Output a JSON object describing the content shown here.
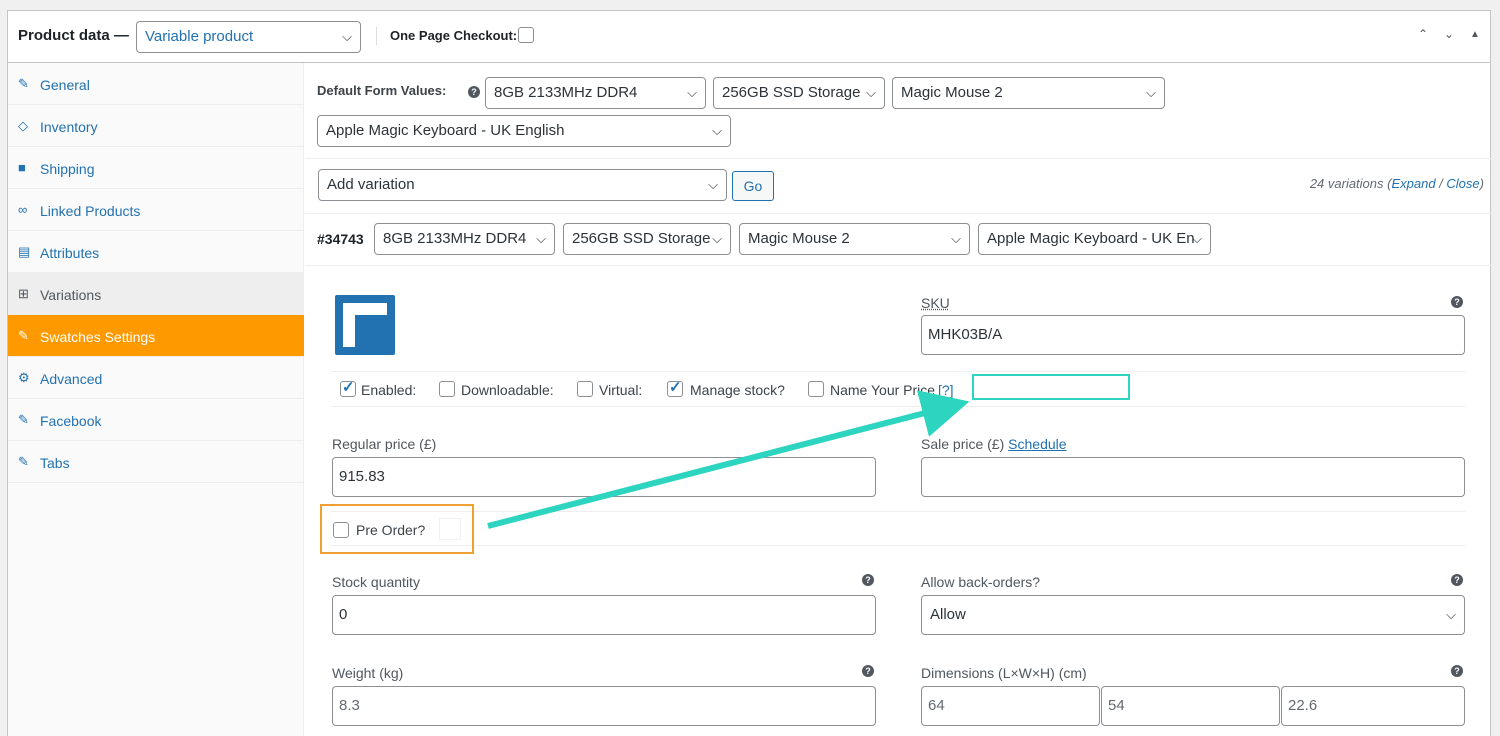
{
  "header": {
    "title": "Product data —",
    "product_type": "Variable product",
    "one_page_checkout_label": "One Page Checkout:"
  },
  "sidebar": {
    "items": [
      {
        "label": "General",
        "icon": "wrench-icon"
      },
      {
        "label": "Inventory",
        "icon": "tag-icon"
      },
      {
        "label": "Shipping",
        "icon": "truck-icon"
      },
      {
        "label": "Linked Products",
        "icon": "link-icon"
      },
      {
        "label": "Attributes",
        "icon": "list-icon"
      },
      {
        "label": "Variations",
        "icon": "grid-icon"
      },
      {
        "label": "Swatches Settings",
        "icon": "wrench-icon"
      },
      {
        "label": "Advanced",
        "icon": "gear-icon"
      },
      {
        "label": "Facebook",
        "icon": "wrench-icon"
      },
      {
        "label": "Tabs",
        "icon": "wrench-icon"
      }
    ],
    "active": "Swatches Settings"
  },
  "defaults": {
    "label": "Default Form Values:",
    "values": [
      "8GB 2133MHz DDR4",
      "256GB SSD Storage",
      "Magic Mouse 2",
      "Apple Magic Keyboard - UK English"
    ]
  },
  "toolbar": {
    "add_variation": "Add variation",
    "go": "Go",
    "count_text": "24 variations (",
    "expand": "Expand",
    "sep": " / ",
    "close": "Close",
    "count_end": ")"
  },
  "variation": {
    "id": "#34743",
    "attributes": [
      "8GB 2133MHz DDR4",
      "256GB SSD Storage",
      "Magic Mouse 2",
      "Apple Magic Keyboard - UK En"
    ],
    "sku_label": "SKU",
    "sku_value": "MHK03B/A",
    "options": {
      "enabled": "Enabled:",
      "downloadable": "Downloadable:",
      "virtual": "Virtual:",
      "manage_stock": "Manage stock?",
      "name_your_price": "Name Your Price",
      "nyp_help": "[?]"
    },
    "regular_price_label": "Regular price (£)",
    "regular_price": "915.83",
    "sale_price_label": "Sale price (£)",
    "schedule": "Schedule",
    "pre_order_label": "Pre Order?",
    "stock_qty_label": "Stock quantity",
    "stock_qty": "0",
    "backorders_label": "Allow back-orders?",
    "backorders_value": "Allow",
    "weight_label": "Weight (kg)",
    "weight_placeholder": "8.3",
    "dimensions_label": "Dimensions (L×W×H) (cm)",
    "dimensions": [
      "64",
      "54",
      "22.6"
    ]
  },
  "colors": {
    "accent": "#2271b1",
    "active_tab": "#ff9900",
    "annotation_teal": "#2dd4bf",
    "annotation_orange": "#f0a030"
  }
}
